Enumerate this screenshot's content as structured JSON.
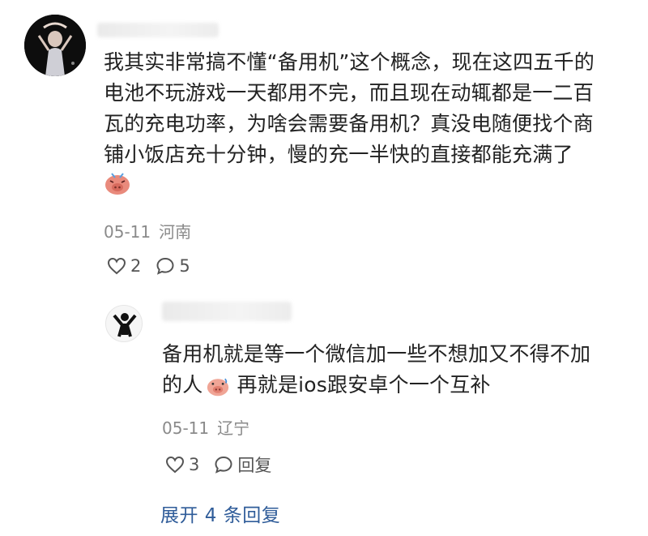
{
  "comment": {
    "lines": [
      "我其实非常搞不懂“备用机”这个概念，现在这四五千的",
      "电池不玩游戏一天都用不完，而且现在动辄都是一二百",
      "瓦的充电功率，为啥会需要备用机？真没电随便找个商",
      "铺小饭店充十分钟，慢的充一半快的直接都能充满了"
    ],
    "emoji": "pig-emoji",
    "date": "05-11",
    "location": "河南",
    "likes": "2",
    "comments": "5"
  },
  "reply": {
    "line1": "备用机就是等一个微信加一些不想加又不得不加",
    "line2_pre": "的人",
    "line2_post": " 再就是ios跟安卓个一个互补",
    "emoji": "pig-emoji",
    "date": "05-11",
    "location": "辽宁",
    "likes": "3",
    "reply_label": "回复"
  },
  "expand_label": "展开 4 条回复",
  "colors": {
    "text": "#222222",
    "meta": "#8a8a8a",
    "link": "#2f5c99"
  }
}
